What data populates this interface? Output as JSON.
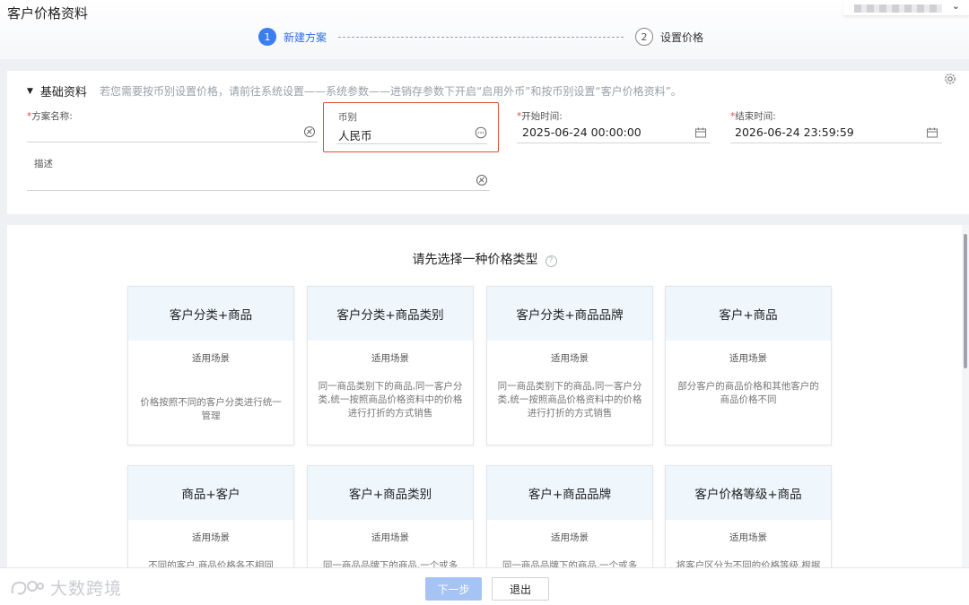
{
  "header": {
    "title": "客户价格资料",
    "steps": [
      {
        "num": "1",
        "label": "新建方案"
      },
      {
        "num": "2",
        "label": "设置价格"
      }
    ]
  },
  "basic": {
    "section_title": "基础资料",
    "section_note": "若您需要按币别设置价格，请前往系统设置——系统参数——进销存参数下开启“启用外币”和按币别设置“客户价格资料”。",
    "fields": {
      "plan_name": {
        "label": "方案名称:",
        "required": "*",
        "value": ""
      },
      "currency": {
        "label": "币别",
        "value": "人民币"
      },
      "start_time": {
        "label": "开始时间:",
        "required": "*",
        "value": "2025-06-24 00:00:00"
      },
      "end_time": {
        "label": "结束时间:",
        "required": "*",
        "value": "2026-06-24 23:59:59"
      },
      "description": {
        "label": "描述",
        "value": ""
      }
    }
  },
  "types": {
    "heading": "请先选择一种价格类型",
    "help_symbol": "?",
    "cards": [
      {
        "title": "客户分类+商品",
        "scene": "适用场景",
        "desc": "价格按照不同的客户分类进行统一管理"
      },
      {
        "title": "客户分类+商品类别",
        "scene": "适用场景",
        "desc": "同一商品类别下的商品,同一客户分类,统一按照商品价格资料中的价格进行打折的方式销售"
      },
      {
        "title": "客户分类+商品品牌",
        "scene": "适用场景",
        "desc": "同一商品类别下的商品,同一客户分类,统一按照商品价格资料中的价格进行打折的方式销售"
      },
      {
        "title": "客户+商品",
        "scene": "适用场景",
        "desc": "部分客户的商品价格和其他客户的商品价格不同"
      },
      {
        "title": "商品+客户",
        "scene": "适用场景",
        "desc": "不同的客户,商品价格各不相同"
      },
      {
        "title": "客户+商品类别",
        "scene": "适用场景",
        "desc": "同一商品品牌下的商品,一个或多"
      },
      {
        "title": "客户+商品品牌",
        "scene": "适用场景",
        "desc": "同一商品品牌下的商品,一个或多"
      },
      {
        "title": "客户价格等级+商品",
        "scene": "适用场景",
        "desc": "将客户区分为不同的价格等级,根据"
      }
    ]
  },
  "footer": {
    "next_label": "下一步",
    "exit_label": "退出",
    "watermark": "大数跨境"
  },
  "colors": {
    "accent": "#3c7ef0",
    "required": "#e64a3b",
    "highlight_border": "#e0503c",
    "card_header_bg": "#eff7fd",
    "next_button_disabled": "#a6c4f3"
  }
}
